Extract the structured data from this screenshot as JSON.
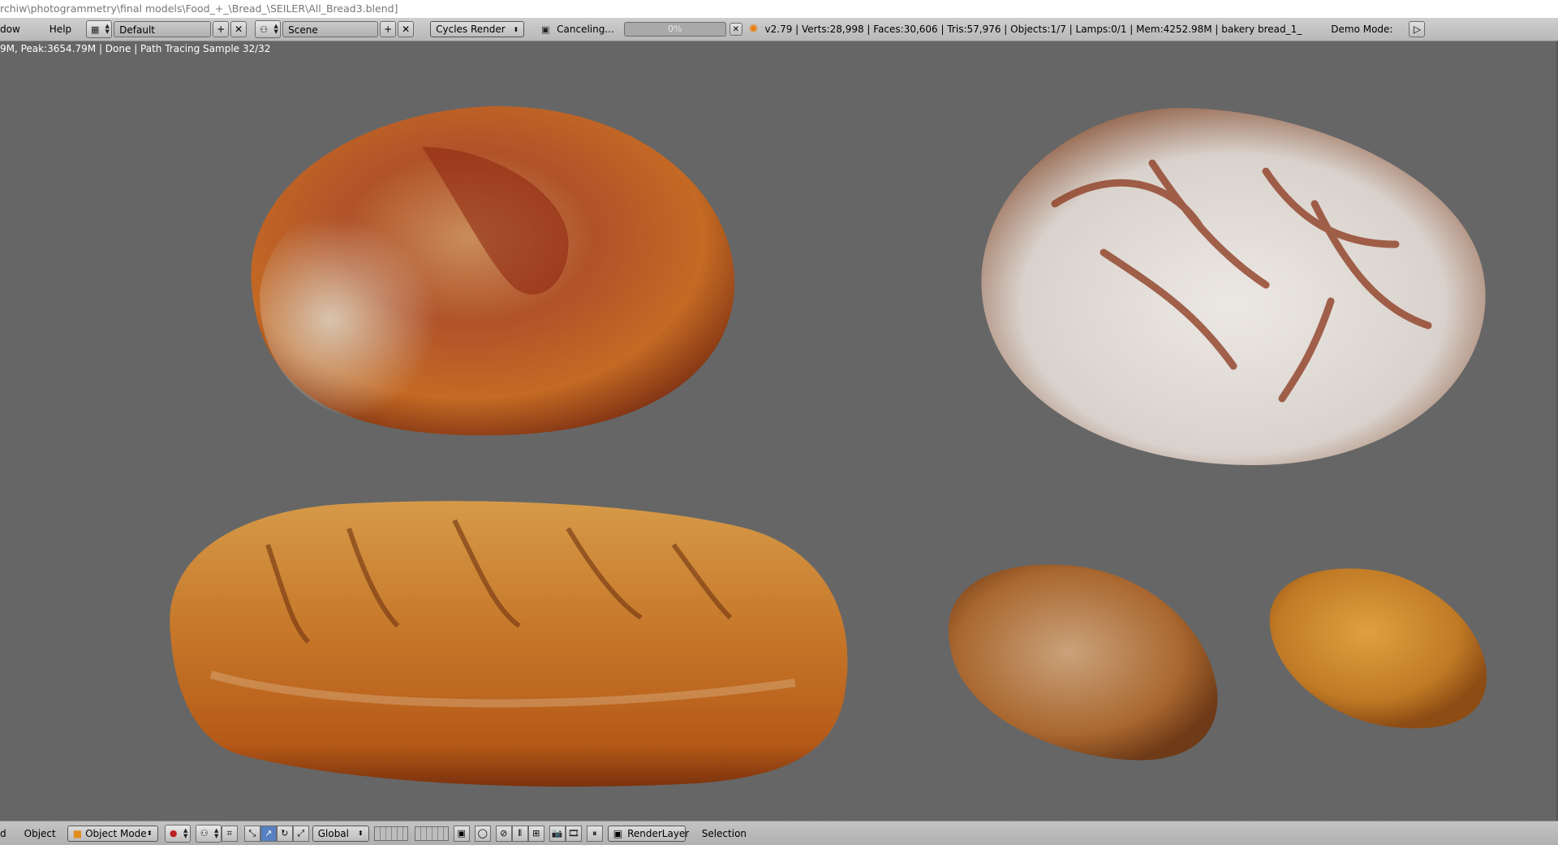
{
  "window": {
    "title": "rchiw\\photogrammetry\\final models\\Food_+_\\Bread_\\SEILER\\All_Bread3.blend]"
  },
  "info_header": {
    "menu": [
      "dow",
      "Help"
    ],
    "screen_layout": "Default",
    "scene": "Scene",
    "render_engine": "Cycles Render",
    "job_status": "Canceling...",
    "progress_text": "0%",
    "progress_value": 0,
    "stats": "v2.79 | Verts:28,998 | Faces:30,606 | Tris:57,976 | Objects:1/7 | Lamps:0/1 | Mem:4252.98M | bakery bread_1_",
    "demo_mode_label": "Demo Mode:"
  },
  "viewport": {
    "render_status": "9M, Peak:3654.79M | Done | Path Tracing Sample 32/32"
  },
  "footer": {
    "view_menu": "d",
    "object_menu": "Object",
    "mode": "Object Mode",
    "orientation": "Global",
    "render_layer": "RenderLayer",
    "selection_label": "Selection"
  },
  "colors": {
    "viewport_bg": "#666666",
    "header_bg": "#b8b8b8",
    "progress_fill": "#5680c2"
  }
}
